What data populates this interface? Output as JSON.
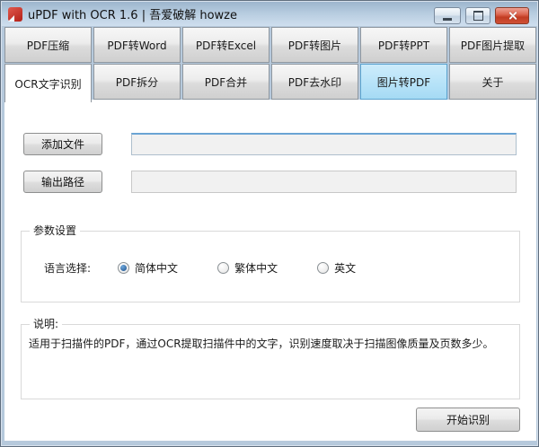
{
  "window": {
    "title": "uPDF with OCR 1.6 |  吾爱破解 howze",
    "icons": {
      "app": "pdf-document-red",
      "minimize": "minimize-dash",
      "maximize": "maximize-square",
      "close": "close-x"
    }
  },
  "colors": {
    "frame": "#b6c9dc",
    "titlebar_top": "#9db6cd",
    "titlebar_bottom": "#cfdfee",
    "close_button": "#c23c22",
    "tab_highlight": "#b5e2f8",
    "active_tab": "#ffffff",
    "focused_field_border": "#6aa4d4",
    "radio_selected": "#1d4f8a"
  },
  "tabs": {
    "row1": [
      {
        "label": "PDF压缩"
      },
      {
        "label": "PDF转Word"
      },
      {
        "label": "PDF转Excel"
      },
      {
        "label": "PDF转图片"
      },
      {
        "label": "PDF转PPT"
      },
      {
        "label": "PDF图片提取"
      }
    ],
    "row2": [
      {
        "label": "OCR文字识别",
        "active": true
      },
      {
        "label": "PDF拆分",
        "active": false
      },
      {
        "label": "PDF合并",
        "active": false
      },
      {
        "label": "PDF去水印",
        "active": false
      },
      {
        "label": "图片转PDF",
        "active": false,
        "highlighted": true
      },
      {
        "label": "关于",
        "active": false
      }
    ]
  },
  "content": {
    "add_file_button": "添加文件",
    "add_file_value": "",
    "output_path_button": "输出路径",
    "output_path_value": "",
    "settings_group": {
      "title": "参数设置",
      "language_label": "语言选择:",
      "options": [
        {
          "label": "简体中文",
          "selected": true
        },
        {
          "label": "繁体中文",
          "selected": false
        },
        {
          "label": "英文",
          "selected": false
        }
      ]
    },
    "description_group": {
      "title": "说明:",
      "text": "适用于扫描件的PDF，通过OCR提取扫描件中的文字，识别速度取决于扫描图像质量及页数多少。"
    },
    "start_button": "开始识别"
  }
}
